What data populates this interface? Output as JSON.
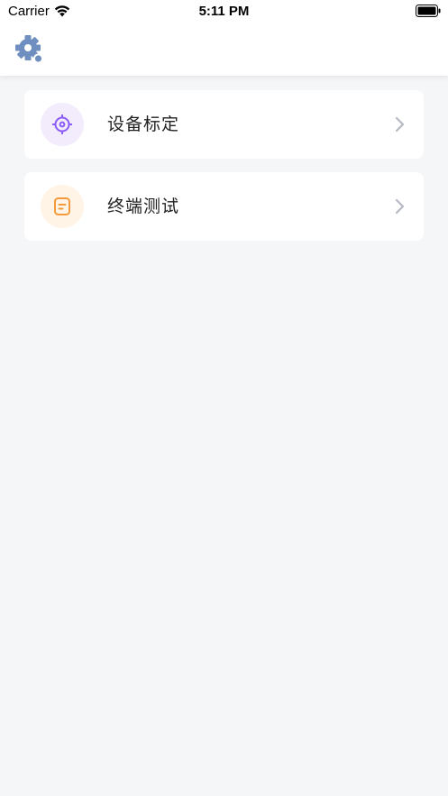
{
  "status_bar": {
    "carrier": "Carrier",
    "time": "5:11 PM"
  },
  "header": {
    "settings_icon": "gear-icon"
  },
  "menu": {
    "items": [
      {
        "label": "设备标定",
        "icon": "target-icon",
        "icon_color": "#8b5cf6",
        "icon_bg": "#f2ecfd"
      },
      {
        "label": "终端测试",
        "icon": "document-icon",
        "icon_color": "#f59a3c",
        "icon_bg": "#fff4e6"
      }
    ]
  },
  "colors": {
    "background": "#f5f6f8",
    "card": "#ffffff",
    "gear": "#6f8fc0",
    "chevron": "#b5b9c2"
  }
}
